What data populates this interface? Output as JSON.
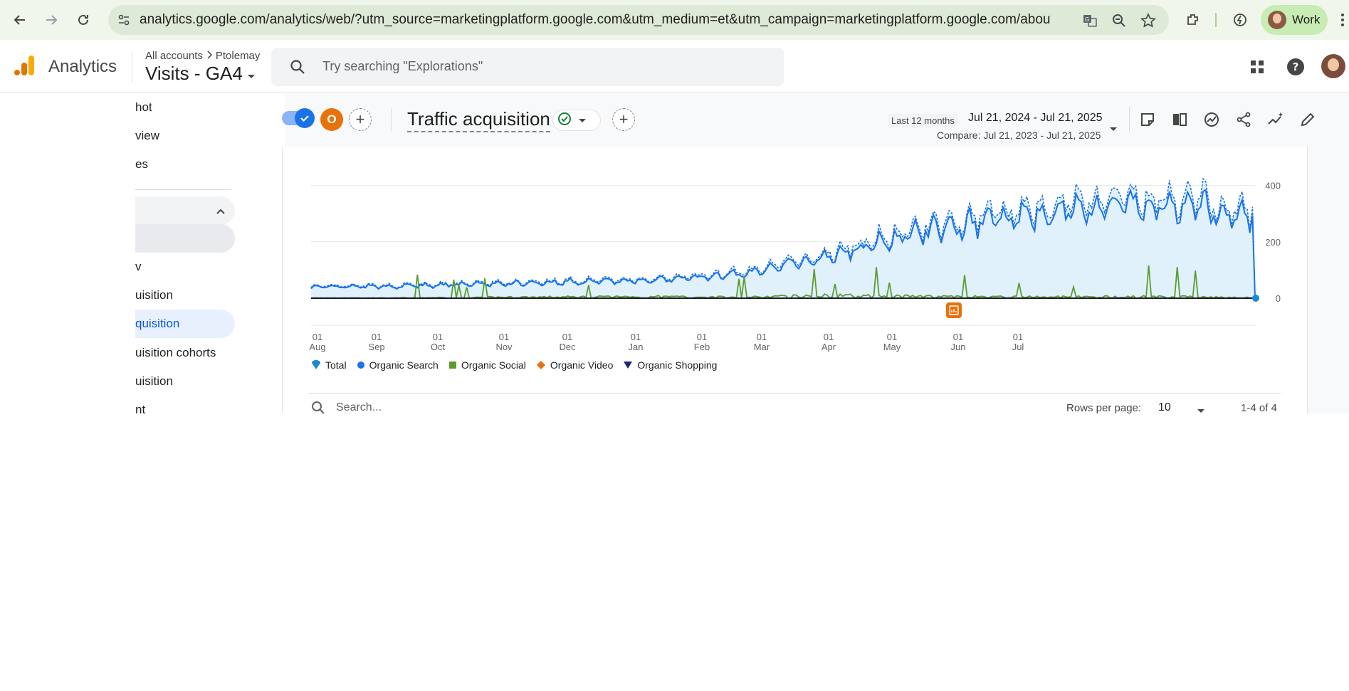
{
  "browser": {
    "url": "analytics.google.com/analytics/web/?utm_source=marketingplatform.google.com&utm_medium=et&utm_campaign=marketingplatform.google.com/about/analytics/#...",
    "profile_label": "Work"
  },
  "header": {
    "app_title": "Analytics",
    "breadcrumb_root": "All accounts",
    "breadcrumb_account": "Ptolemay",
    "property_name": "Visits - GA4",
    "search_placeholder": "Try searching \"Explorations\""
  },
  "sidebar": {
    "items": [
      {
        "label": "hot"
      },
      {
        "label": "view"
      },
      {
        "label": "es"
      },
      {
        "label": "v"
      },
      {
        "label": "uisition"
      },
      {
        "label": "quisition"
      },
      {
        "label": "uisition cohorts"
      },
      {
        "label": "uisition"
      },
      {
        "label": "nt"
      }
    ]
  },
  "toolbar": {
    "segment_letter": "O",
    "report_title": "Traffic acquisition",
    "date_preset": "Last 12 months",
    "date_range": "Jul 21, 2024 - Jul 21, 2025",
    "compare_range": "Compare: Jul 21, 2023 - Jul 21, 2025"
  },
  "chart_data": {
    "type": "line",
    "y_ticks": [
      "400",
      "200",
      "0"
    ],
    "ylim": [
      0,
      450
    ],
    "x_ticks": [
      {
        "day": "01",
        "month": "Aug"
      },
      {
        "day": "01",
        "month": "Sep"
      },
      {
        "day": "01",
        "month": "Oct"
      },
      {
        "day": "01",
        "month": "Nov"
      },
      {
        "day": "01",
        "month": "Dec"
      },
      {
        "day": "01",
        "month": "Jan"
      },
      {
        "day": "01",
        "month": "Feb"
      },
      {
        "day": "01",
        "month": "Mar"
      },
      {
        "day": "01",
        "month": "Apr"
      },
      {
        "day": "01",
        "month": "May"
      },
      {
        "day": "01",
        "month": "Jun"
      },
      {
        "day": "01",
        "month": "Jul"
      }
    ],
    "series": [
      {
        "name": "Total",
        "color": "#1a73e8",
        "values_monthly_approx": [
          40,
          45,
          55,
          65,
          70,
          95,
          160,
          245,
          290,
          330,
          340,
          300
        ]
      },
      {
        "name": "Organic Search",
        "color": "#1a73e8",
        "values_monthly_approx": [
          38,
          42,
          50,
          58,
          62,
          85,
          150,
          230,
          280,
          320,
          330,
          295
        ]
      },
      {
        "name": "Organic Social",
        "color": "#5c9c2f",
        "values_monthly_approx": [
          3,
          5,
          15,
          20,
          25,
          15,
          40,
          30,
          20,
          20,
          25,
          10
        ]
      },
      {
        "name": "Organic Video",
        "color": "#e8710a",
        "values_monthly_approx": [
          0,
          0,
          0,
          0,
          0,
          0,
          0,
          0,
          0,
          0,
          0,
          0
        ]
      },
      {
        "name": "Organic Shopping",
        "color": "#1a237e",
        "values_monthly_approx": [
          0,
          0,
          0,
          0,
          0,
          0,
          0,
          0,
          0,
          0,
          0,
          0
        ]
      }
    ],
    "legend_position": "bottom-left"
  },
  "legend": [
    {
      "label": "Total",
      "color": "#1a8ad4"
    },
    {
      "label": "Organic Search",
      "color": "#1a73e8"
    },
    {
      "label": "Organic Social",
      "color": "#5c9c2f"
    },
    {
      "label": "Organic Video",
      "color": "#e8710a"
    },
    {
      "label": "Organic Shopping",
      "color": "#1a237e"
    }
  ],
  "table": {
    "search_placeholder": "Search...",
    "rows_per_page_label": "Rows per page:",
    "rows_per_page_value": "10",
    "page_info": "1-4 of 4"
  }
}
